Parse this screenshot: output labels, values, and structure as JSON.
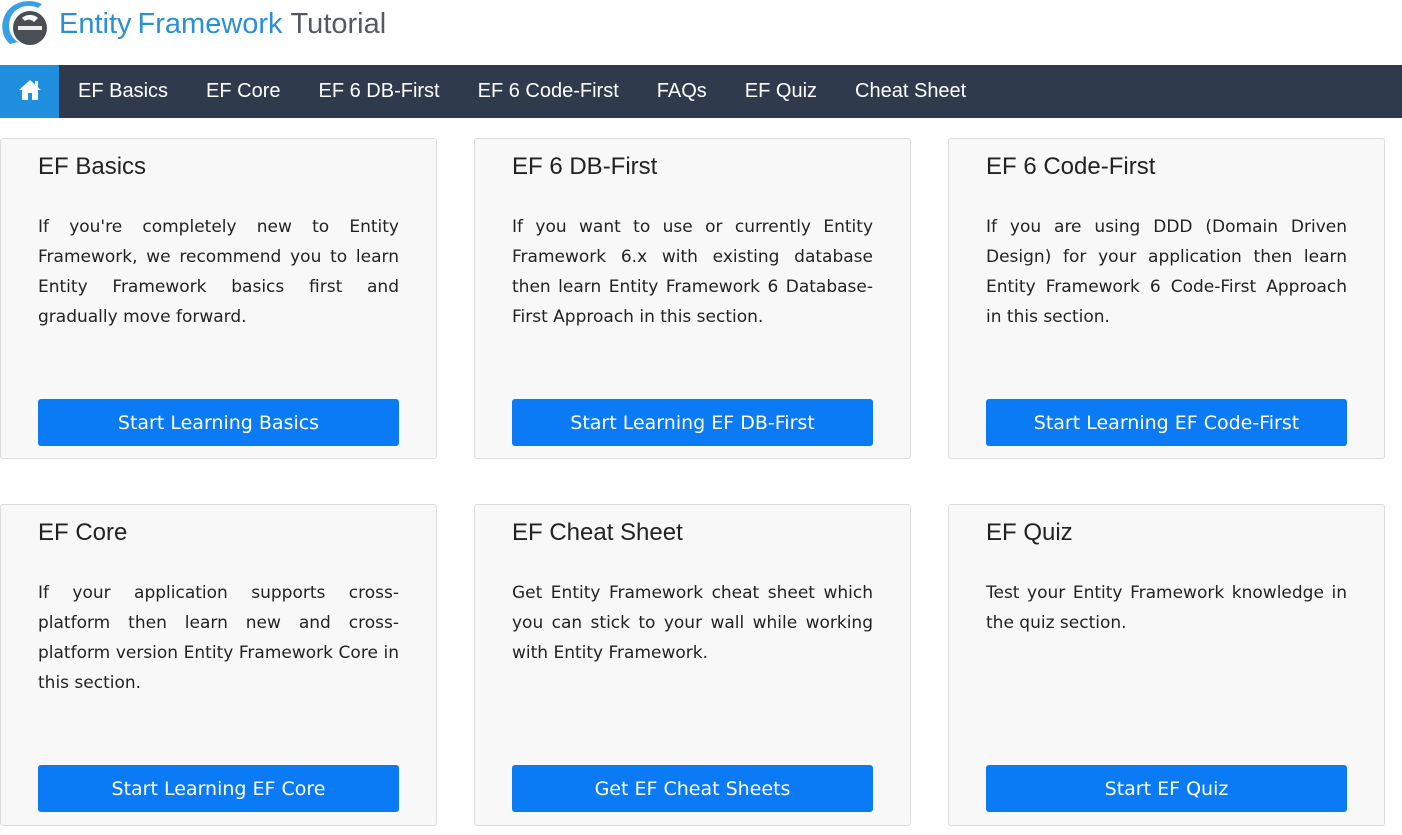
{
  "logo": {
    "part1": "Entity",
    "part2": "Framework",
    "part3": "Tutorial"
  },
  "nav": {
    "home_icon": "home-icon",
    "items": [
      "EF Basics",
      "EF Core",
      "EF 6 DB-First",
      "EF 6 Code-First",
      "FAQs",
      "EF Quiz",
      "Cheat Sheet"
    ]
  },
  "colors": {
    "nav_bg": "#2f3b4d",
    "home_bg": "#1f8fde",
    "button": "#0a7bf5",
    "card_bg": "#f8f8f8",
    "logo_blue": "#2a8fd6"
  },
  "cards": [
    {
      "title": "EF Basics",
      "text": "If you're completely new to Entity Framework, we recommend you to learn Entity Framework basics first and gradually move forward.",
      "button": "Start Learning Basics"
    },
    {
      "title": "EF 6 DB-First",
      "text": "If you want to use or currently Entity Framework 6.x with existing database then learn Entity Framework 6 Database-First Approach in this section.",
      "button": "Start Learning EF DB-First"
    },
    {
      "title": "EF 6 Code-First",
      "text": "If you are using DDD (Domain Driven Design) for your application then learn Entity Framework 6 Code-First Approach in this section.",
      "button": "Start Learning EF Code-First"
    },
    {
      "title": "EF Core",
      "text": "If your application supports cross-platform then learn new and cross-platform version Entity Framework Core in this section.",
      "button": "Start Learning EF Core"
    },
    {
      "title": "EF Cheat Sheet",
      "text": "Get Entity Framework cheat sheet which you can stick to your wall while working with Entity Framework.",
      "button": "Get EF Cheat Sheets"
    },
    {
      "title": "EF Quiz",
      "text": "Test your Entity Framework knowledge in the quiz section.",
      "button": "Start EF Quiz"
    }
  ]
}
